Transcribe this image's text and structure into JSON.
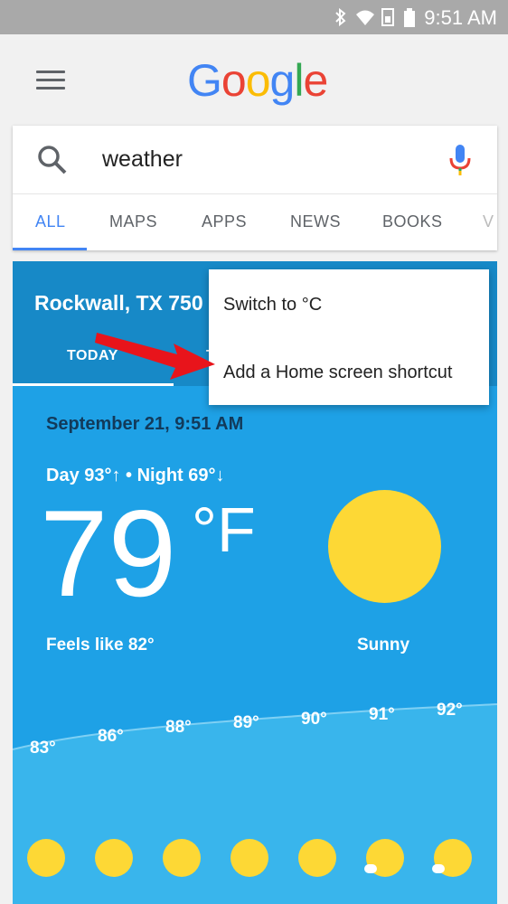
{
  "status_bar": {
    "time": "9:51 AM"
  },
  "search": {
    "logo": "Google",
    "query": "weather"
  },
  "tabs": [
    {
      "label": "ALL"
    },
    {
      "label": "MAPS"
    },
    {
      "label": "APPS"
    },
    {
      "label": "NEWS"
    },
    {
      "label": "BOOKS"
    },
    {
      "label": "V"
    }
  ],
  "weather": {
    "location": "Rockwall, TX 750",
    "tab_today": "TODAY",
    "tab_tomorrow": "T",
    "date_time": "September 21, 9:51 AM",
    "day_night": "Day 93°↑ • Night 69°↓",
    "temperature": "79",
    "unit": "°F",
    "feels_like": "Feels like 82°",
    "condition": "Sunny",
    "hourly": [
      "83°",
      "86°",
      "88°",
      "89°",
      "90°",
      "91°",
      "92°"
    ]
  },
  "menu": {
    "switch_unit": "Switch to °C",
    "add_shortcut": "Add a Home screen shortcut"
  },
  "colors": {
    "blue": "#4285f4",
    "red": "#ea4335",
    "yellow": "#fbbc05",
    "green": "#34a853",
    "card_blue": "#1ea1e6",
    "header_blue": "#1789c7",
    "sun": "#fdd835",
    "arrow_red": "#e8141b"
  }
}
